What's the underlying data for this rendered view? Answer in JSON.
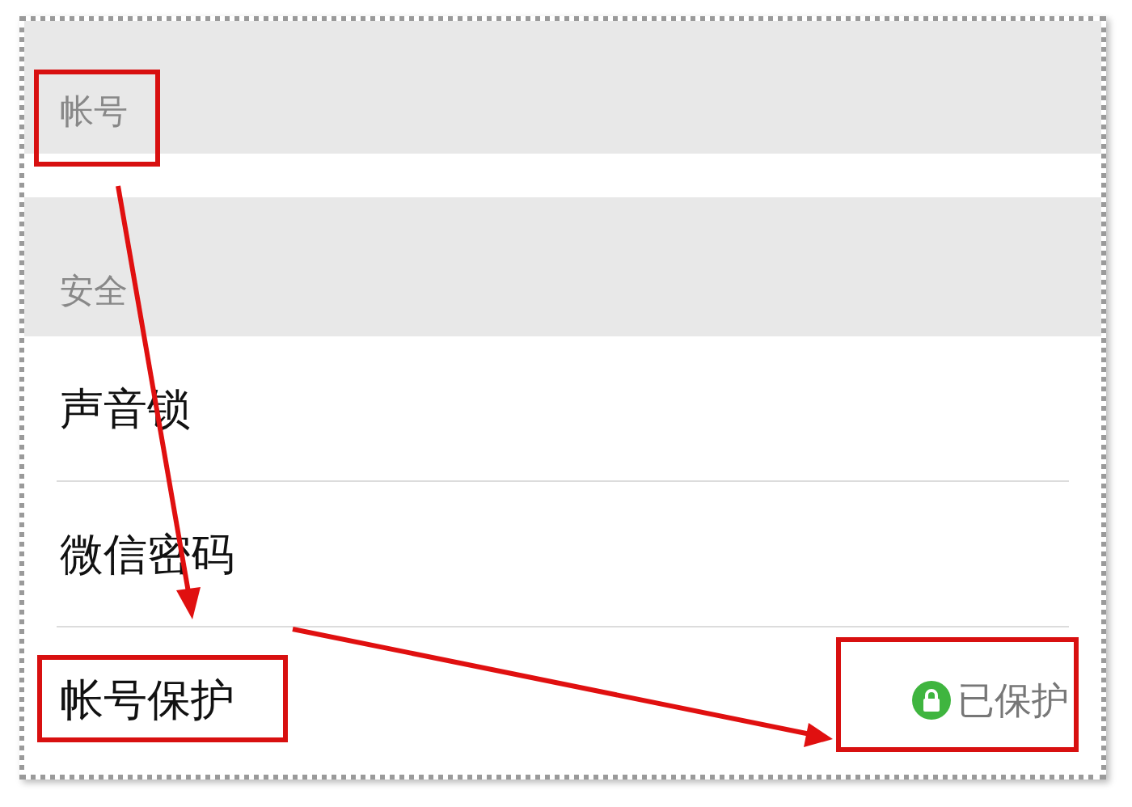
{
  "sections": [
    {
      "header": "帐号"
    },
    {
      "header": "安全",
      "rows": [
        {
          "label": "声音锁"
        },
        {
          "label": "微信密码"
        },
        {
          "label": "帐号保护",
          "status": "已保护"
        }
      ]
    }
  ]
}
